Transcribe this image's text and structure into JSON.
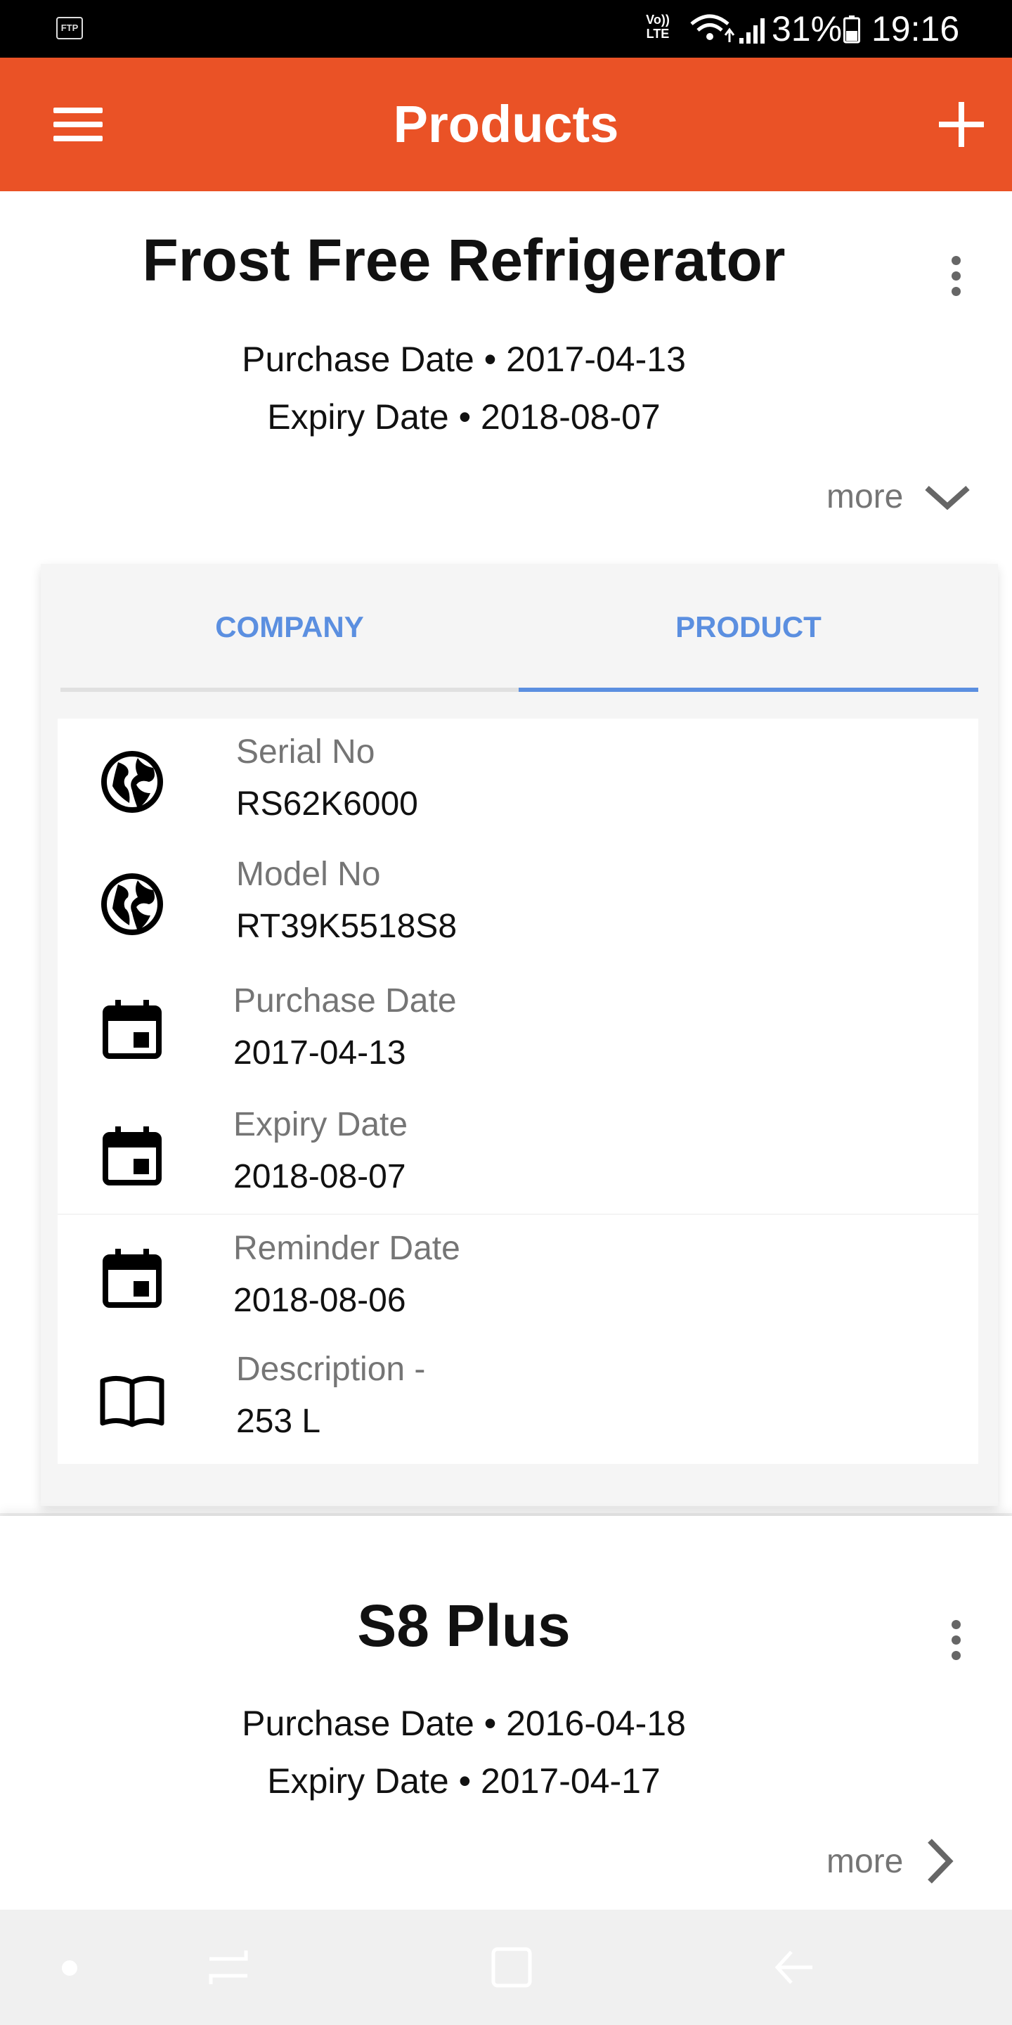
{
  "status_bar": {
    "volte": "Vo)) LTE",
    "battery": "31%",
    "time": "19:16"
  },
  "app_bar": {
    "title": "Products",
    "menu_icon": "hamburger-menu-icon",
    "add_icon": "plus-icon",
    "color": "#ea5226"
  },
  "products": [
    {
      "name": "Frost Free Refrigerator",
      "purchase_line": "Purchase Date • 2017-04-13",
      "expiry_line": "Expiry Date • 2018-08-07",
      "more_label": "more",
      "tabs": [
        {
          "label": "COMPANY"
        },
        {
          "label": "PRODUCT"
        }
      ],
      "active_tab": "PRODUCT",
      "details": [
        {
          "icon": "globe-icon",
          "label": "Serial No",
          "value": "RS62K6000"
        },
        {
          "icon": "globe-icon",
          "label": "Model No",
          "value": "RT39K5518S8"
        },
        {
          "icon": "calendar-icon",
          "label": "Purchase Date",
          "value": "2017-04-13"
        },
        {
          "icon": "calendar-icon",
          "label": "Expiry Date",
          "value": "2018-08-07"
        },
        {
          "icon": "calendar-icon",
          "label": "Reminder Date",
          "value": "2018-08-06"
        },
        {
          "icon": "book-icon",
          "label": "Description -",
          "value": "253 L"
        }
      ]
    },
    {
      "name": "S8 Plus",
      "purchase_line": "Purchase Date • 2016-04-18",
      "expiry_line": "Expiry Date • 2017-04-17",
      "more_label": "more"
    }
  ],
  "colors": {
    "accent_tab": "#5b8fe0",
    "text_secondary": "#757575"
  }
}
